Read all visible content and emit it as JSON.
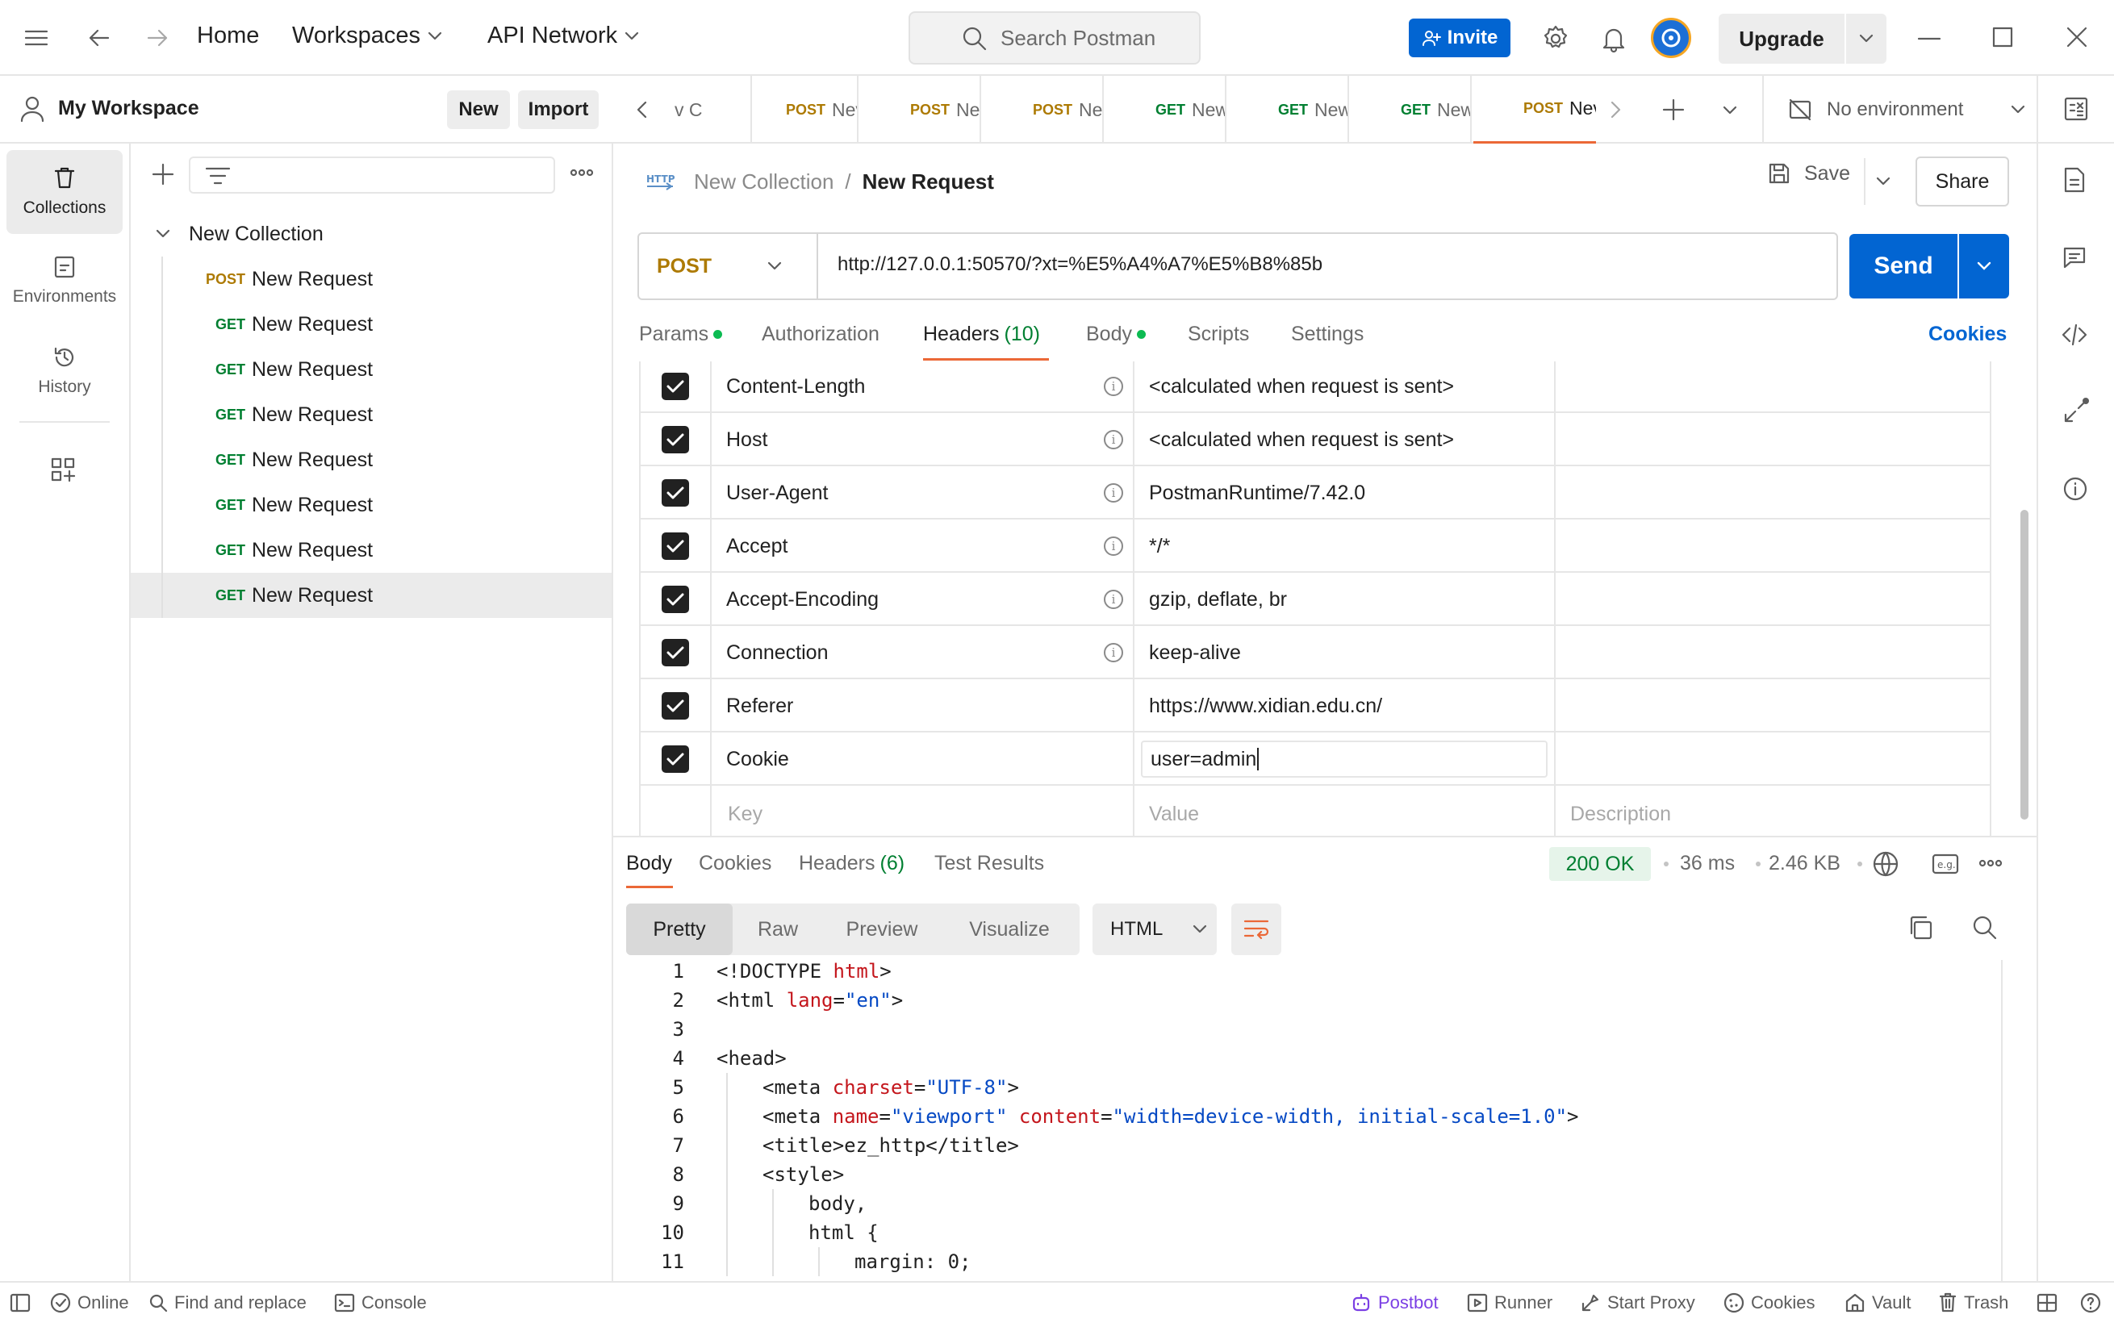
{
  "topbar": {
    "home": "Home",
    "workspaces": "Workspaces",
    "api_network": "API Network",
    "search_placeholder": "Search Postman",
    "invite": "Invite",
    "upgrade": "Upgrade"
  },
  "workspace": {
    "name": "My Workspace",
    "new_label": "New",
    "import_label": "Import"
  },
  "tabs": [
    {
      "method": "",
      "label": "v C",
      "dot": false
    },
    {
      "method": "POST",
      "label": "Nev",
      "dot": true
    },
    {
      "method": "POST",
      "label": "Nev",
      "dot": true
    },
    {
      "method": "POST",
      "label": "Nev",
      "dot": true
    },
    {
      "method": "GET",
      "label": "New",
      "dot": true
    },
    {
      "method": "GET",
      "label": "New",
      "dot": true
    },
    {
      "method": "GET",
      "label": "New",
      "dot": true
    },
    {
      "method": "POST",
      "label": "Nev",
      "dot": true
    }
  ],
  "environment": "No environment",
  "rail": {
    "collections": "Collections",
    "environments": "Environments",
    "history": "History"
  },
  "sidebar": {
    "collection_name": "New Collection",
    "items": [
      {
        "method": "POST",
        "label": "New Request"
      },
      {
        "method": "GET",
        "label": "New Request"
      },
      {
        "method": "GET",
        "label": "New Request"
      },
      {
        "method": "GET",
        "label": "New Request"
      },
      {
        "method": "GET",
        "label": "New Request"
      },
      {
        "method": "GET",
        "label": "New Request"
      },
      {
        "method": "GET",
        "label": "New Request"
      },
      {
        "method": "GET",
        "label": "New Request"
      }
    ]
  },
  "request": {
    "breadcrumb_collection": "New Collection",
    "breadcrumb_sep": "/",
    "breadcrumb_request": "New Request",
    "save": "Save",
    "share": "Share",
    "method": "POST",
    "url": "http://127.0.0.1:50570/?xt=%E5%A4%A7%E5%B8%85b",
    "send": "Send",
    "tabs": {
      "params": "Params",
      "authorization": "Authorization",
      "headers": "Headers",
      "headers_count": "(10)",
      "body": "Body",
      "scripts": "Scripts",
      "settings": "Settings",
      "cookies": "Cookies"
    }
  },
  "headers": [
    {
      "key": "Content-Length",
      "value": "<calculated when request is sent>",
      "info": true
    },
    {
      "key": "Host",
      "value": "<calculated when request is sent>",
      "info": true
    },
    {
      "key": "User-Agent",
      "value": "PostmanRuntime/7.42.0",
      "info": true
    },
    {
      "key": "Accept",
      "value": "*/*",
      "info": true
    },
    {
      "key": "Accept-Encoding",
      "value": "gzip, deflate, br",
      "info": true
    },
    {
      "key": "Connection",
      "value": "keep-alive",
      "info": true
    },
    {
      "key": "Referer",
      "value": "https://www.xidian.edu.cn/",
      "info": false
    },
    {
      "key": "Cookie",
      "value": "user=admin",
      "info": false
    }
  ],
  "header_placeholders": {
    "key": "Key",
    "value": "Value",
    "description": "Description"
  },
  "response": {
    "tabs": {
      "body": "Body",
      "cookies": "Cookies",
      "headers": "Headers",
      "headers_count": "(6)",
      "test_results": "Test Results"
    },
    "status": "200 OK",
    "time": "36 ms",
    "size": "2.46 KB",
    "views": [
      "Pretty",
      "Raw",
      "Preview",
      "Visualize"
    ],
    "format": "HTML",
    "code_lines": [
      {
        "n": "1",
        "indent": 0,
        "parts": [
          [
            "tag",
            "<!DOCTYPE "
          ],
          [
            "attr",
            "html"
          ],
          [
            "tag",
            ">"
          ]
        ]
      },
      {
        "n": "2",
        "indent": 0,
        "parts": [
          [
            "tag",
            "<html "
          ],
          [
            "attr",
            "lang"
          ],
          [
            "tag",
            "="
          ],
          [
            "str",
            "\"en\""
          ],
          [
            "tag",
            ">"
          ]
        ]
      },
      {
        "n": "3",
        "indent": 0,
        "parts": []
      },
      {
        "n": "4",
        "indent": 0,
        "parts": [
          [
            "tag",
            "<head>"
          ]
        ]
      },
      {
        "n": "5",
        "indent": 1,
        "parts": [
          [
            "tag",
            "<meta "
          ],
          [
            "attr",
            "charset"
          ],
          [
            "tag",
            "="
          ],
          [
            "str",
            "\"UTF-8\""
          ],
          [
            "tag",
            ">"
          ]
        ]
      },
      {
        "n": "6",
        "indent": 1,
        "parts": [
          [
            "tag",
            "<meta "
          ],
          [
            "attr",
            "name"
          ],
          [
            "tag",
            "="
          ],
          [
            "str",
            "\"viewport\""
          ],
          [
            "tag",
            " "
          ],
          [
            "attr",
            "content"
          ],
          [
            "tag",
            "="
          ],
          [
            "str",
            "\"width=device-width, initial-scale=1.0\""
          ],
          [
            "tag",
            ">"
          ]
        ]
      },
      {
        "n": "7",
        "indent": 1,
        "parts": [
          [
            "tag",
            "<title>ez_http</title>"
          ]
        ]
      },
      {
        "n": "8",
        "indent": 1,
        "parts": [
          [
            "tag",
            "<style>"
          ]
        ]
      },
      {
        "n": "9",
        "indent": 2,
        "parts": [
          [
            "tag",
            "body,"
          ]
        ]
      },
      {
        "n": "10",
        "indent": 2,
        "parts": [
          [
            "tag",
            "html {"
          ]
        ]
      },
      {
        "n": "11",
        "indent": 3,
        "parts": [
          [
            "tag",
            "margin: 0;"
          ]
        ]
      }
    ]
  },
  "statusbar": {
    "online": "Online",
    "find_replace": "Find and replace",
    "console": "Console",
    "postbot": "Postbot",
    "runner": "Runner",
    "start_proxy": "Start Proxy",
    "cookies": "Cookies",
    "vault": "Vault",
    "trash": "Trash"
  },
  "colors": {
    "accent_blue": "#0265d2",
    "post_method": "#ad7a03",
    "get_method": "#007f31",
    "status_ok": "#007f31",
    "unsaved_dot": "#eb6837",
    "tab_underline": "#eb6837"
  }
}
